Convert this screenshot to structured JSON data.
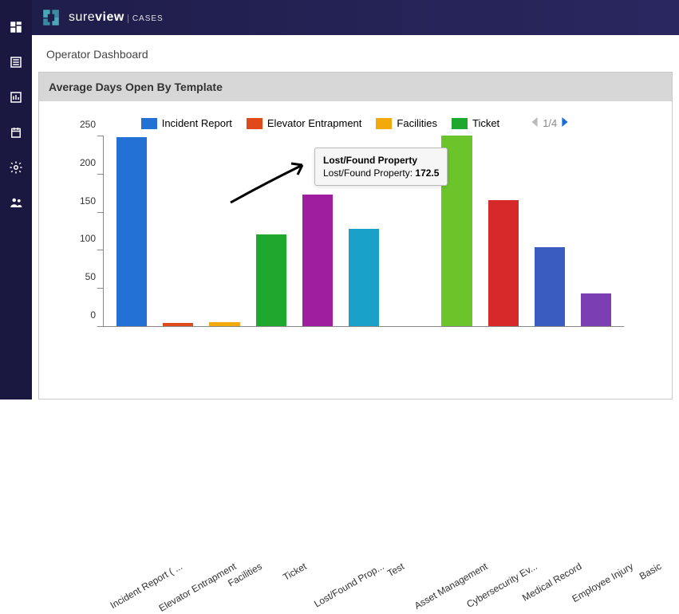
{
  "brand": {
    "name_a": "sure",
    "name_b": "view",
    "sub": "CASES"
  },
  "page": {
    "title": "Operator Dashboard"
  },
  "card": {
    "title": "Average Days Open By Template"
  },
  "legend": [
    {
      "label": "Incident Report",
      "color": "#2471d6"
    },
    {
      "label": "Elevator Entrapment",
      "color": "#e04a1b"
    },
    {
      "label": "Facilities",
      "color": "#f2a90c"
    },
    {
      "label": "Ticket",
      "color": "#1ea82e"
    }
  ],
  "pager": {
    "text": "1/4"
  },
  "tooltip": {
    "title": "Lost/Found Property",
    "series": "Lost/Found Property",
    "value": "172.5"
  },
  "colors": {
    "incident": "#2471d6",
    "elevator": "#e04a1b",
    "facilities": "#f2a90c",
    "ticket": "#1ea82e",
    "lostfound": "#9f1ea0",
    "test": "#1aa1c9",
    "asset": "#aaaaaa",
    "cyber": "#6ac42a",
    "medical": "#d62a2a",
    "employee": "#3a5bbf",
    "basic": "#7b3fb3"
  },
  "chart_data": {
    "type": "bar",
    "title": "Average Days Open By Template",
    "xlabel": "",
    "ylabel": "",
    "ylim": [
      0,
      250
    ],
    "yticks": [
      0,
      50,
      100,
      150,
      200,
      250
    ],
    "categories": [
      "Incident Report ( ...",
      "Elevator Entrapment",
      "Facilities",
      "Ticket",
      "Lost/Found Prop...",
      "Test",
      "Asset Management",
      "Cybersecurity Ev...",
      "Medical Record",
      "Employee Injury",
      "Basic"
    ],
    "values": [
      248,
      4,
      5,
      120,
      172.5,
      128,
      0,
      250,
      165,
      104,
      43
    ],
    "series_colors": [
      "incident",
      "elevator",
      "facilities",
      "ticket",
      "lostfound",
      "test",
      "asset",
      "cyber",
      "medical",
      "employee",
      "basic"
    ]
  }
}
